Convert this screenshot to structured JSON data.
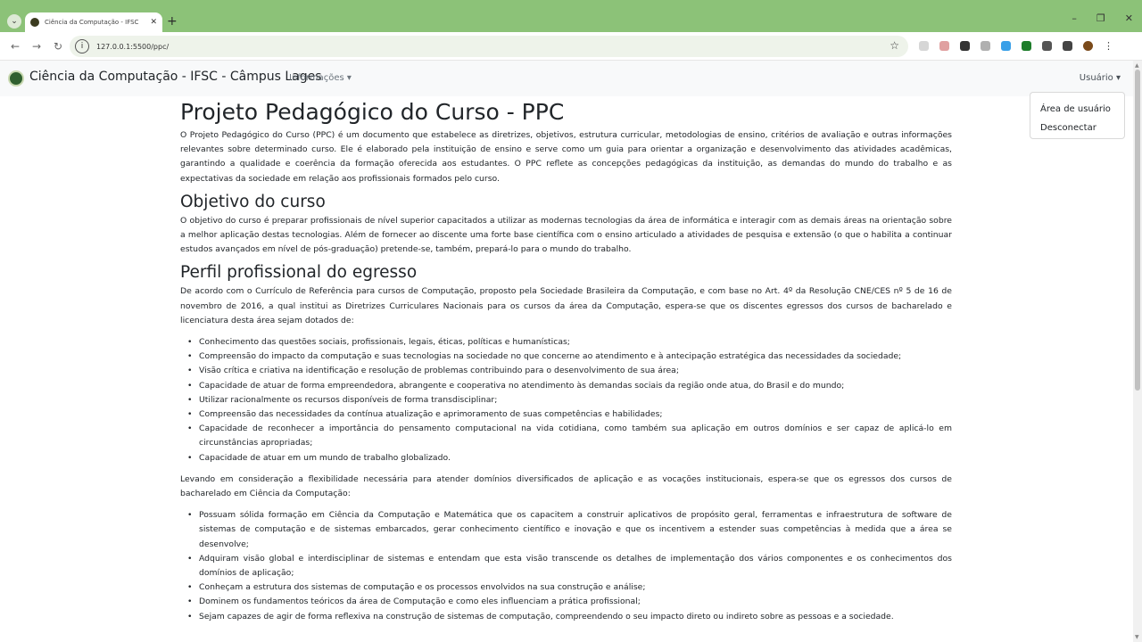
{
  "browser": {
    "tab_title": "Ciência da Computação - IFSC",
    "url": "127.0.0.1:5500/ppc/"
  },
  "navbar": {
    "brand": "Ciência da Computação - IFSC - Câmpus Lages",
    "info_menu": "Informações ▾",
    "user_menu": "Usuário ▾"
  },
  "user_dropdown": [
    "Área de usuário",
    "Desconectar"
  ],
  "content": {
    "title": "Projeto Pedagógico do Curso - PPC",
    "intro": "O Projeto Pedagógico do Curso (PPC) é um documento que estabelece as diretrizes, objetivos, estrutura curricular, metodologias de ensino, critérios de avaliação e outras informações relevantes sobre determinado curso. Ele é elaborado pela instituição de ensino e serve como um guia para orientar a organização e desenvolvimento das atividades acadêmicas, garantindo a qualidade e coerência da formação oferecida aos estudantes. O PPC reflete as concepções pedagógicas da instituição, as demandas do mundo do trabalho e as expectativas da sociedade em relação aos profissionais formados pelo curso.",
    "objective_heading": "Objetivo do curso",
    "objective_text": "O objetivo do curso é preparar profissionais de nível superior capacitados a utilizar as modernas tecnologias da área de informática e interagir com as demais áreas na orientação sobre a melhor aplicação destas tecnologias. Além de fornecer ao discente uma forte base científica com o ensino articulado a atividades de pesquisa e extensão (o que o habilita a continuar estudos avançados em nível de pós-graduação) pretende-se, também, prepará-lo para o mundo do trabalho.",
    "profile_heading": "Perfil profissional do egresso",
    "profile_text": "De acordo com o Currículo de Referência para cursos de Computação, proposto pela Sociedade Brasileira da Computação, e com base no Art. 4º da Resolução CNE/CES nº 5 de 16 de novembro de 2016, a qual institui as Diretrizes Curriculares Nacionais para os cursos da área da Computação, espera-se que os discentes egressos dos cursos de bacharelado e licenciatura desta área sejam dotados de:",
    "profile_list": [
      "Conhecimento das questões sociais, profissionais, legais, éticas, políticas e humanísticas;",
      "Compreensão do impacto da computação e suas tecnologias na sociedade no que concerne ao atendimento e à antecipação estratégica das necessidades da sociedade;",
      "Visão crítica e criativa na identificação e resolução de problemas contribuindo para o desenvolvimento de sua área;",
      "Capacidade de atuar de forma empreendedora, abrangente e cooperativa no atendimento às demandas sociais da região onde atua, do Brasil e do mundo;",
      "Utilizar racionalmente os recursos disponíveis de forma transdisciplinar;",
      "Compreensão das necessidades da contínua atualização e aprimoramento de suas competências e habilidades;",
      "Capacidade de reconhecer a importância do pensamento computacional na vida cotidiana, como também sua aplicação em outros domínios e ser capaz de aplicá-lo em circunstâncias apropriadas;",
      "Capacidade de atuar em um mundo de trabalho globalizado."
    ],
    "bacharelado_text": "Levando em consideração a flexibilidade necessária para atender domínios diversificados de aplicação e as vocações institucionais, espera-se que os egressos dos cursos de bacharelado em Ciência da Computação:",
    "bacharelado_list": [
      "Possuam sólida formação em Ciência da Computação e Matemática que os capacitem a construir aplicativos de propósito geral, ferramentas e infraestrutura de software de sistemas de computação e de sistemas embarcados, gerar conhecimento científico e inovação e que os incentivem a estender suas competências à medida que a área se desenvolve;",
      "Adquiram visão global e interdisciplinar de sistemas e entendam que esta visão transcende os detalhes de implementação dos vários componentes e os conhecimentos dos domínios de aplicação;",
      "Conheçam a estrutura dos sistemas de computação e os processos envolvidos na sua construção e análise;",
      "Dominem os fundamentos teóricos da área de Computação e como eles influenciam a prática profissional;",
      "Sejam capazes de agir de forma reflexiva na construção de sistemas de computação, compreendendo o seu impacto direto ou indireto sobre as pessoas e a sociedade."
    ]
  }
}
